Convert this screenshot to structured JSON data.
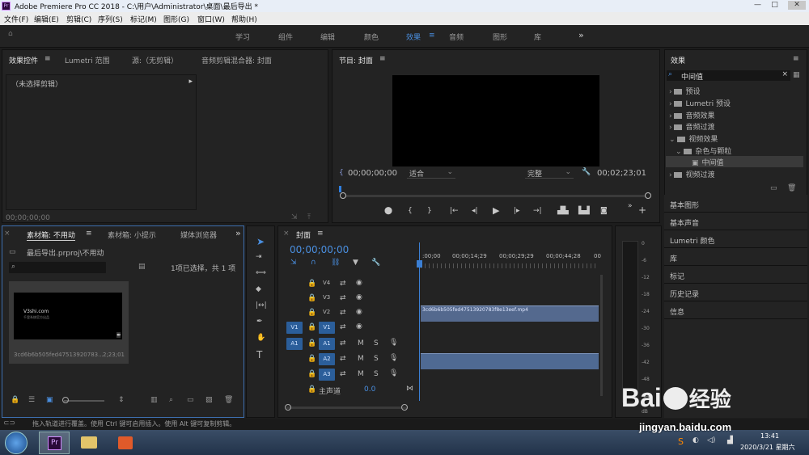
{
  "window": {
    "title": "Adobe Premiere Pro CC 2018 - C:\\用户\\Administrator\\桌面\\最后导出 *",
    "logo": "Pr"
  },
  "menu": [
    "文件(F)",
    "编辑(E)",
    "剪辑(C)",
    "序列(S)",
    "标记(M)",
    "图形(G)",
    "窗口(W)",
    "帮助(H)"
  ],
  "workspaces": {
    "items": [
      "学习",
      "组件",
      "编辑",
      "颜色",
      "效果",
      "音频",
      "图形",
      "库"
    ],
    "active": "效果",
    "more": "»"
  },
  "source_panel": {
    "tabs": [
      "效果控件",
      "Lumetri 范围",
      "源:（无剪辑）",
      "音频剪辑混合器: 封面"
    ],
    "no_clip": "（未选择剪辑）",
    "timecode": "00;00;00;00"
  },
  "program": {
    "title": "节目: 封面",
    "timecode": "00;00;00;00",
    "fit": "适合",
    "quality": "完整",
    "duration": "00;02;23;01"
  },
  "project": {
    "tabs": [
      "素材箱: 不用动",
      "素材箱: 小提示",
      "媒体浏览器"
    ],
    "path": "最后导出.prproj\\不用动",
    "selection": "1项已选择，共 1 项",
    "clip_name": "3cd6b6b505fed47513920783...",
    "clip_duration": "2;23;01",
    "thumb_text": "V3shi.com",
    "thumb_sub": "千里系统官方出品"
  },
  "timeline": {
    "title": "封面",
    "timecode": "00;00;00;00",
    "ruler": [
      ":00;00",
      "00;00;14;29",
      "00;00;29;29",
      "00;00;44;28",
      "00"
    ],
    "tracks_video": [
      "V4",
      "V3",
      "V2",
      "V1"
    ],
    "tracks_audio": [
      "A1",
      "A2",
      "A3"
    ],
    "src_v": "V1",
    "src_a": "A1",
    "master": "主声道",
    "master_val": "0.0",
    "clip": "3cd6b6b505fed47513920783f8e13eef.mp4"
  },
  "meter": {
    "scale": [
      "0",
      "-6",
      "-12",
      "-18",
      "-24",
      "-30",
      "-36",
      "-42",
      "-48",
      "-54"
    ],
    "db": "dB"
  },
  "effects": {
    "title": "效果",
    "search": "中间值",
    "tree": [
      "预设",
      "Lumetri 预设",
      "音频效果",
      "音频过渡",
      "视频效果",
      "杂色与颗粒",
      "中间值",
      "视频过渡"
    ],
    "sections": [
      "基本图形",
      "基本声音",
      "Lumetri 颜色",
      "库",
      "标记",
      "历史记录",
      "信息"
    ]
  },
  "status": "拖入轨道进行覆盖。使用 Ctrl 键可启用插入。使用 Alt 键可复制剪辑。",
  "taskbar": {
    "time": "13:41",
    "date": "2020/3/21 星期六"
  },
  "watermark": {
    "brand": "Bai",
    "brand2": "经验",
    "url": "jingyan.baidu.com"
  }
}
